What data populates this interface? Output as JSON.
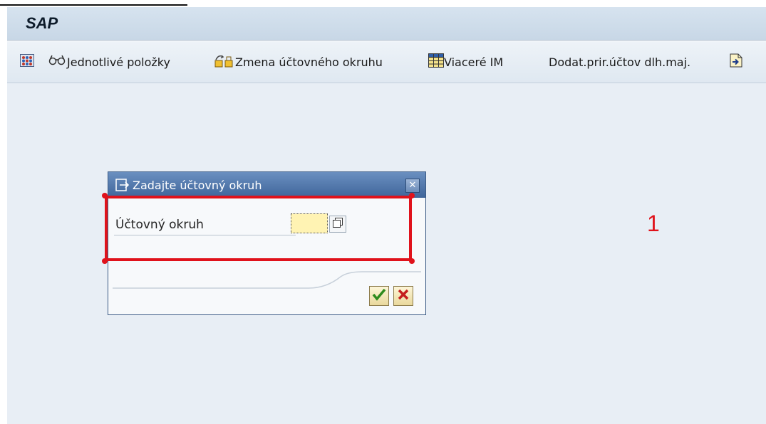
{
  "window": {
    "title": "SAP"
  },
  "toolbar": {
    "items": [
      {
        "label": "",
        "icon": "overview-grid-icon"
      },
      {
        "label": "Jednotlivé položky",
        "icon": "glasses-icon"
      },
      {
        "label": "Zmena účtovného okruhu",
        "icon": "change-company-code-icon"
      },
      {
        "label": "Viaceré IM",
        "icon": "table-icon"
      },
      {
        "label": "Dodat.prir.účtov dlh.maj.",
        "icon": ""
      },
      {
        "label": "",
        "icon": "document-export-icon"
      }
    ]
  },
  "dialog": {
    "title": "Zadajte účtovný okruh",
    "field_label": "Účtovný okruh",
    "field_value": "",
    "buttons": {
      "ok": "check-icon",
      "cancel": "cancel-x-icon"
    }
  },
  "annotation": {
    "number": "1"
  },
  "colors": {
    "annotation_red": "#e0121b",
    "dialog_title_blue": "#3f659a",
    "input_yellow": "#fff3b3"
  }
}
